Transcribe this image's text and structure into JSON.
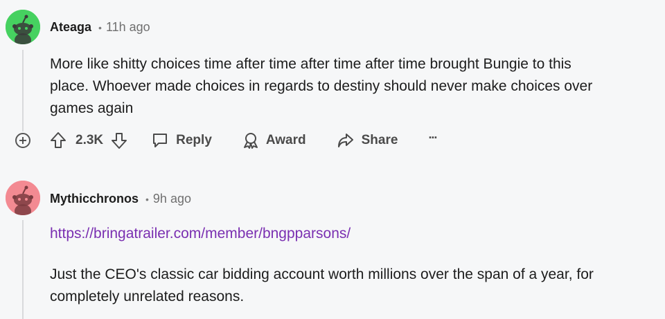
{
  "comments": [
    {
      "username": "Ateaga",
      "separator": "•",
      "time": "11h ago",
      "avatar_color": "#46d160",
      "body_lines": [
        "More like shitty choices time after time after time after time brought Bungie to this",
        "place. Whoever made choices in regards to destiny should never make choices over",
        "games again"
      ],
      "actions": {
        "expand_icon": "plus-circle-icon",
        "upvote_icon": "arrow-up-icon",
        "score": "2.3K",
        "downvote_icon": "arrow-down-icon",
        "reply_label": "Reply",
        "award_label": "Award",
        "share_label": "Share",
        "more_label": "···"
      }
    },
    {
      "username": "Mythicchronos",
      "separator": "•",
      "time": "9h ago",
      "avatar_color": "#ff585b",
      "link": "https://bringatrailer.com/member/bngpparsons/",
      "body_lines": [
        "Just the CEO's classic car bidding account worth millions over the span of a year, for",
        "completely unrelated reasons."
      ]
    }
  ],
  "colors": {
    "background": "#f6f7f8",
    "link": "#7a2fb1",
    "thread_line": "#d8dadc"
  }
}
